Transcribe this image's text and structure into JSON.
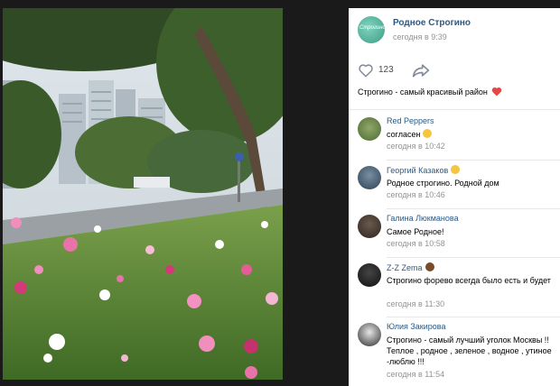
{
  "post": {
    "group_name": "Родное Строгино",
    "avatar_text": "Строгино",
    "time": "сегодня в 9:39",
    "likes": "123",
    "text": "Строгино - самый красивый район"
  },
  "comments": [
    {
      "author": "Red Peppers",
      "text": "согласен",
      "time": "сегодня в 10:42",
      "emoji": "grin-emoji"
    },
    {
      "author": "Георгий Казаков",
      "text": "Родное строгино. Родной дом",
      "time": "сегодня в 10:46",
      "emoji": "smile-emoji"
    },
    {
      "author": "Галина Люкманова",
      "text": "Самое Родное!",
      "time": "сегодня в 10:58"
    },
    {
      "author": "Z-Z Zema",
      "text": "Строгино форево всегда было есть и будет",
      "time": "сегодня в 11:30",
      "emoji": "poop-emoji"
    },
    {
      "author": "Юлия Закирова",
      "text": "Строгино - самый лучший уголок Москвы !! Теплое , родное , зеленое , водное , утиное -люблю !!!",
      "time": "сегодня в 11:54"
    }
  ],
  "colors": {
    "link": "#2a5885",
    "meta": "#939393",
    "background": "#1a1a1b",
    "accent_heart": "#e64646"
  }
}
